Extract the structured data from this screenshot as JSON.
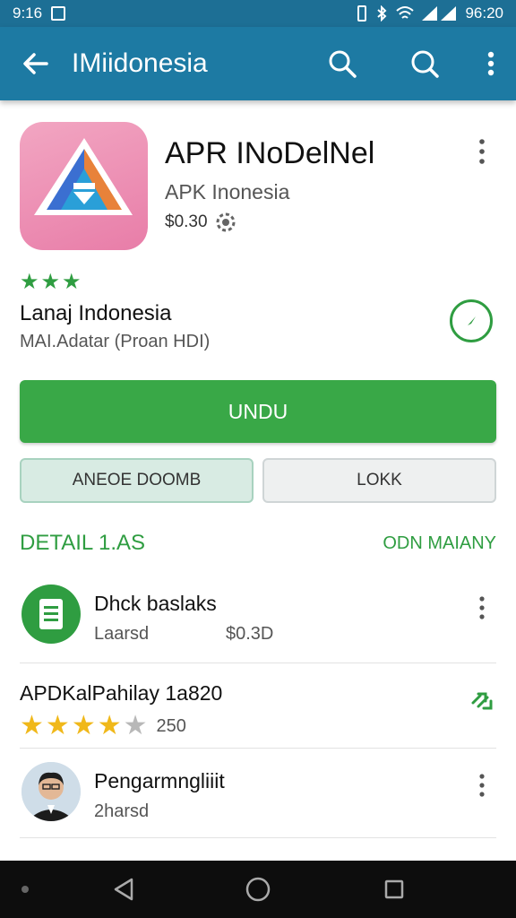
{
  "status_bar": {
    "time_left": "9:16",
    "time_right": "96:20"
  },
  "app_bar": {
    "title": "IMiidonesia"
  },
  "app": {
    "name": "APR INoDelNel",
    "developer": "APK Inonesia",
    "price": "$0.30",
    "rating_stars": 3,
    "language_label": "Lanaj Indonesia",
    "language_sub": "MAI.Adatar (Proan HDI)"
  },
  "buttons": {
    "install": "UNDU",
    "secondary_left": "ANEOE DOOMB",
    "secondary_right": "LOKK"
  },
  "details": {
    "title": "DETAIL 1.AS",
    "more": "ODN MAIANY"
  },
  "items": [
    {
      "title": "Dhck baslaks",
      "sub": "Laarsd",
      "price": "$0.3D"
    },
    {
      "title": "APDKalPahilay 1a820",
      "rating": 4,
      "count": "250"
    },
    {
      "title": "Pengarmngliiit",
      "sub": "2harsd"
    }
  ],
  "colors": {
    "appbar": "#1d7aa3",
    "accent_green": "#2f9d41",
    "install_green": "#39a847",
    "star_yellow": "#f0b81a"
  }
}
